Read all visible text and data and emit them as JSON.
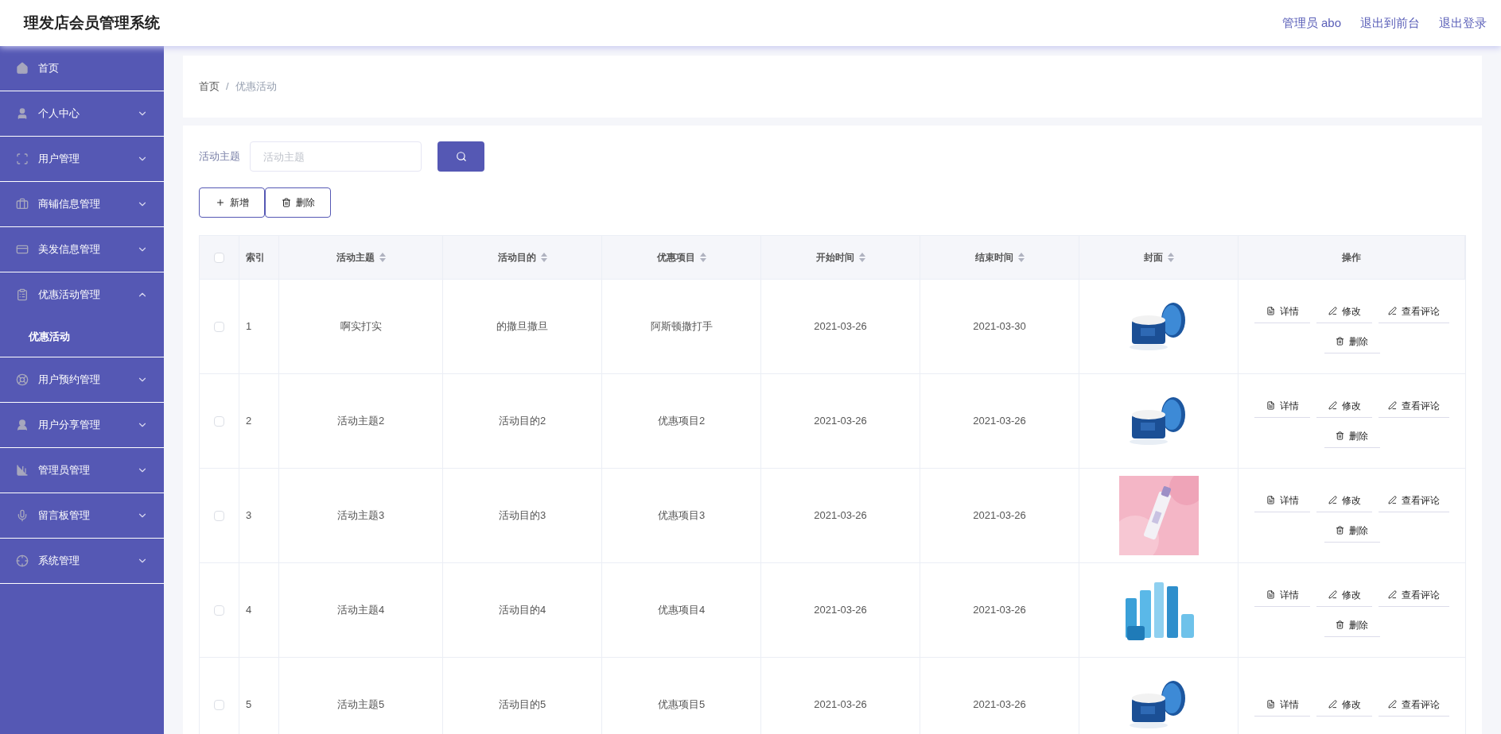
{
  "header": {
    "title": "理发店会员管理系统",
    "links": [
      "管理员 abo",
      "退出到前台",
      "退出登录"
    ]
  },
  "sidebar": {
    "items": [
      {
        "label": "首页",
        "kind": "link"
      },
      {
        "label": "个人中心",
        "kind": "menu",
        "expanded": false
      },
      {
        "label": "用户管理",
        "kind": "menu",
        "expanded": false
      },
      {
        "label": "商铺信息管理",
        "kind": "menu",
        "expanded": false
      },
      {
        "label": "美发信息管理",
        "kind": "menu",
        "expanded": false
      },
      {
        "label": "优惠活动管理",
        "kind": "menu",
        "expanded": true,
        "children": [
          {
            "label": "优惠活动",
            "selected": true
          }
        ]
      },
      {
        "label": "用户预约管理",
        "kind": "menu",
        "expanded": false
      },
      {
        "label": "用户分享管理",
        "kind": "menu",
        "expanded": false
      },
      {
        "label": "管理员管理",
        "kind": "menu",
        "expanded": false
      },
      {
        "label": "留言板管理",
        "kind": "menu",
        "expanded": false
      },
      {
        "label": "系统管理",
        "kind": "menu",
        "expanded": false
      }
    ]
  },
  "breadcrumb": [
    "首页",
    "/",
    "优惠活动"
  ],
  "search": {
    "label": "活动主题",
    "placeholder": "活动主题"
  },
  "toolbar": [
    "新增",
    "删除"
  ],
  "table": {
    "columns": [
      {
        "label": "索引",
        "sortable": false
      },
      {
        "label": "活动主题",
        "sortable": true
      },
      {
        "label": "活动目的",
        "sortable": true
      },
      {
        "label": "优惠项目",
        "sortable": true
      },
      {
        "label": "开始时间",
        "sortable": true
      },
      {
        "label": "结束时间",
        "sortable": true
      },
      {
        "label": "封面",
        "sortable": true
      },
      {
        "label": "操作",
        "sortable": false
      }
    ],
    "header_checked": false,
    "rows": [
      {
        "checked": false,
        "cells": [
          "1",
          "啊实打实",
          "的撒旦撒旦",
          "阿斯顿撒打手",
          "2021-03-26",
          "2021-03-30"
        ],
        "cover": {
          "kind": "picture"
        },
        "actions": [
          "详情",
          "修改",
          "查看评论",
          "删除"
        ]
      },
      {
        "checked": false,
        "cells": [
          "2",
          "活动主题2",
          "活动目的2",
          "优惠项目2",
          "2021-03-26",
          "2021-03-26"
        ],
        "cover": {
          "kind": "picture"
        },
        "actions": [
          "详情",
          "修改",
          "查看评论",
          "删除"
        ]
      },
      {
        "checked": false,
        "cells": [
          "3",
          "活动主题3",
          "活动目的3",
          "优惠项目3",
          "2021-03-26",
          "2021-03-26"
        ],
        "cover": {
          "kind": "picture"
        },
        "actions": [
          "详情",
          "修改",
          "查看评论",
          "删除"
        ]
      },
      {
        "checked": false,
        "cells": [
          "4",
          "活动主题4",
          "活动目的4",
          "优惠项目4",
          "2021-03-26",
          "2021-03-26"
        ],
        "cover": {
          "kind": "picture"
        },
        "actions": [
          "详情",
          "修改",
          "查看评论",
          "删除"
        ]
      },
      {
        "checked": false,
        "cells": [
          "5",
          "活动主题5",
          "活动目的5",
          "优惠项目5",
          "2021-03-26",
          "2021-03-26"
        ],
        "cover": {
          "kind": "picture"
        },
        "actions": [
          "详情",
          "修改",
          "查看评论"
        ]
      }
    ]
  }
}
